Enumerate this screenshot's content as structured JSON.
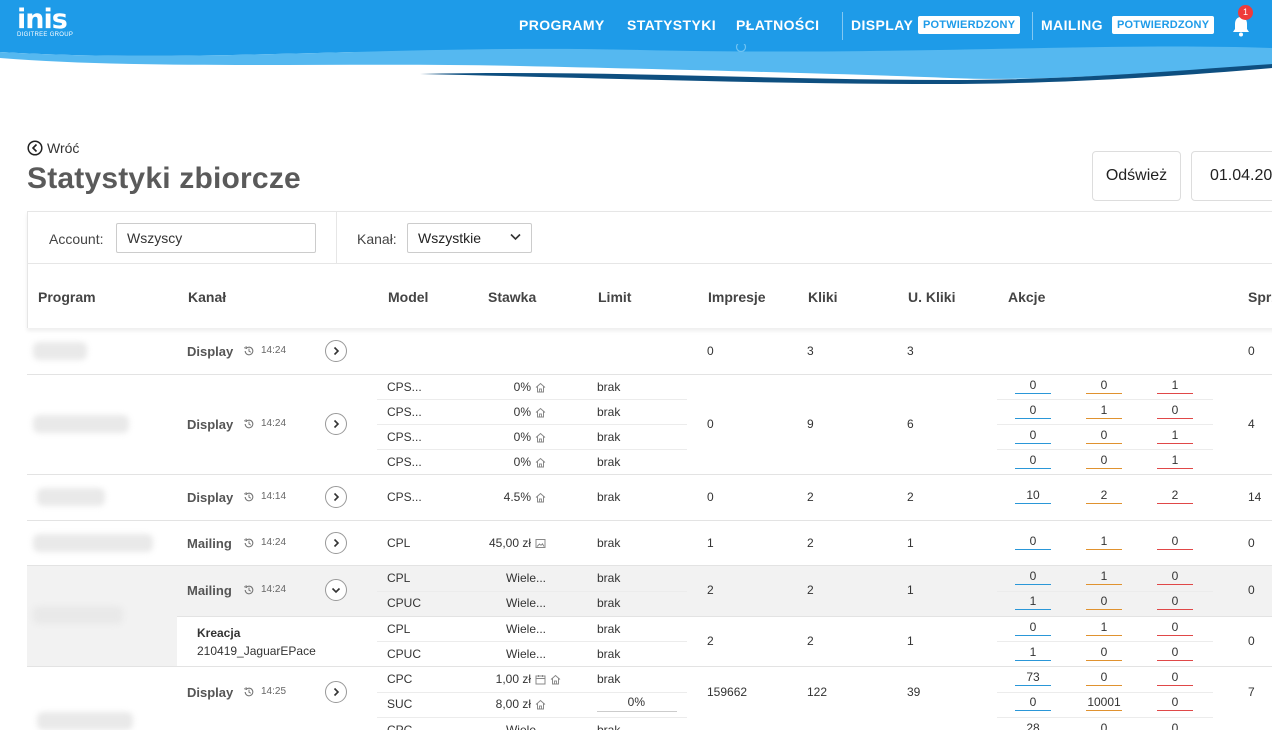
{
  "header": {
    "logo": "inis",
    "logo_sub": "DIGITREE GROUP",
    "nav": [
      "PROGRAMY",
      "STATYSTYKI",
      "PŁATNOŚCI"
    ],
    "display_label": "DISPLAY",
    "display_status": "POTWIERDZONY",
    "mailing_label": "MAILING",
    "mailing_status": "POTWIERDZONY",
    "notifications": "1",
    "colors": {
      "brand": "#1e9be8",
      "wave_dark": "#0e4f80",
      "badge_red": "#ef3b3b"
    }
  },
  "page": {
    "back": "Wróć",
    "title": "Statystyki zbiorcze",
    "refresh": "Odśwież",
    "date": "01.04.20"
  },
  "filters": {
    "account_label": "Account:",
    "account_value": "Wszyscy",
    "channel_label": "Kanał:",
    "channel_value": "Wszystkie"
  },
  "columns": {
    "program": "Program",
    "kanal": "Kanał",
    "model": "Model",
    "stawka": "Stawka",
    "limit": "Limit",
    "impresje": "Impresje",
    "kliki": "Kliki",
    "u_kliki": "U. Kliki",
    "akcje": "Akcje",
    "sprz": "Sprz"
  },
  "rows": [
    {
      "channel": "Display",
      "time": "14:24",
      "impresje": "0",
      "kliki": "3",
      "u_kliki": "3",
      "sprz": "0"
    },
    {
      "channel": "Display",
      "time": "14:24",
      "impresje": "0",
      "kliki": "9",
      "u_kliki": "6",
      "sprz": "4",
      "sub": [
        {
          "model": "CPS...",
          "stawka": "0%",
          "limit": "brak",
          "akcje": [
            "0",
            "0",
            "1"
          ]
        },
        {
          "model": "CPS...",
          "stawka": "0%",
          "limit": "brak",
          "akcje": [
            "0",
            "1",
            "0"
          ]
        },
        {
          "model": "CPS...",
          "stawka": "0%",
          "limit": "brak",
          "akcje": [
            "0",
            "0",
            "1"
          ]
        },
        {
          "model": "CPS...",
          "stawka": "0%",
          "limit": "brak",
          "akcje": [
            "0",
            "0",
            "1"
          ]
        }
      ]
    },
    {
      "channel": "Display",
      "time": "14:14",
      "impresje": "0",
      "kliki": "2",
      "u_kliki": "2",
      "sprz": "14",
      "sub": [
        {
          "model": "CPS...",
          "stawka": "4.5%",
          "limit": "brak",
          "akcje": [
            "10",
            "2",
            "2"
          ]
        }
      ]
    },
    {
      "channel": "Mailing",
      "time": "14:24",
      "impresje": "1",
      "kliki": "2",
      "u_kliki": "1",
      "sprz": "0",
      "sub": [
        {
          "model": "CPL",
          "stawka": "45,00 zł",
          "limit": "brak",
          "akcje": [
            "0",
            "1",
            "0"
          ]
        }
      ]
    },
    {
      "channel": "Mailing",
      "time": "14:24",
      "impresje": "2",
      "kliki": "2",
      "u_kliki": "1",
      "sprz": "0",
      "sub": [
        {
          "model": "CPL",
          "stawka": "Wiele...",
          "limit": "brak",
          "akcje": [
            "0",
            "1",
            "0"
          ]
        },
        {
          "model": "CPUC",
          "stawka": "Wiele...",
          "limit": "brak",
          "akcje": [
            "1",
            "0",
            "0"
          ]
        }
      ]
    },
    {
      "creative_label": "Kreacja",
      "creative_name": "210419_JaguarEPace",
      "impresje": "2",
      "kliki": "2",
      "u_kliki": "1",
      "sprz": "0",
      "sub": [
        {
          "model": "CPL",
          "stawka": "Wiele...",
          "limit": "brak",
          "akcje": [
            "0",
            "1",
            "0"
          ]
        },
        {
          "model": "CPUC",
          "stawka": "Wiele...",
          "limit": "brak",
          "akcje": [
            "1",
            "0",
            "0"
          ]
        }
      ]
    },
    {
      "channel": "Display",
      "time": "14:25",
      "impresje": "159662",
      "kliki": "122",
      "u_kliki": "39",
      "sprz": "7",
      "sub": [
        {
          "model": "CPC",
          "stawka": "1,00 zł",
          "limit": "brak",
          "akcje": [
            "73",
            "0",
            "0"
          ]
        },
        {
          "model": "SUC",
          "stawka": "8,00 zł",
          "limit": "0%",
          "akcje": [
            "0",
            "10001",
            "0"
          ]
        },
        {
          "model": "CPC",
          "stawka": "Wiele...",
          "limit": "brak",
          "akcje": [
            "28",
            "0",
            "0"
          ]
        }
      ]
    }
  ],
  "action_colors": [
    "#2a97d8",
    "#e0922f",
    "#e04848"
  ]
}
